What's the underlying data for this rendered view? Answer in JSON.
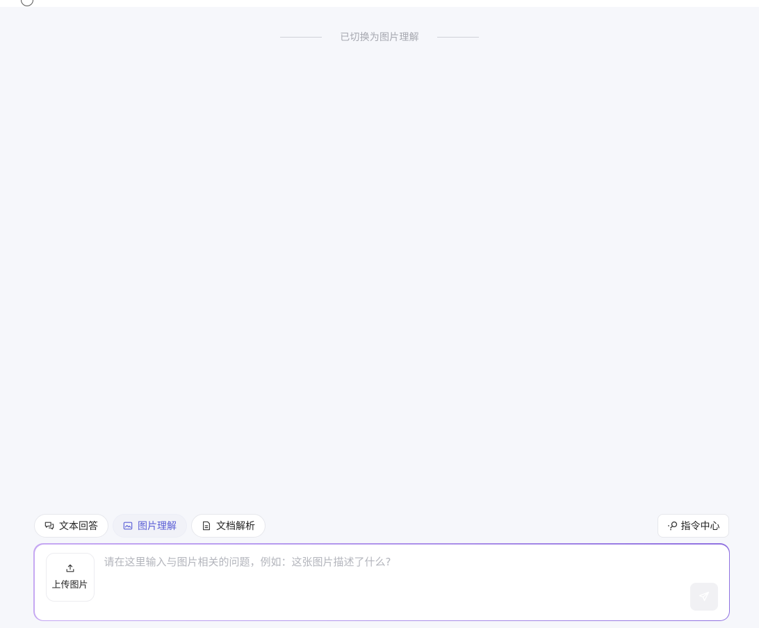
{
  "notice": {
    "text": "已切换为图片理解"
  },
  "modes": [
    {
      "label": "文本回答",
      "icon": "chat-icon",
      "active": false
    },
    {
      "label": "图片理解",
      "icon": "image-icon",
      "active": true
    },
    {
      "label": "文档解析",
      "icon": "document-icon",
      "active": false
    }
  ],
  "command_center": {
    "label": "指令中心",
    "icon": "command-icon"
  },
  "composer": {
    "upload_label": "上传图片",
    "upload_icon": "upload-icon",
    "placeholder": "请在这里输入与图片相关的问题，例如：这张图片描述了什么?",
    "value": "",
    "send_icon": "send-icon"
  },
  "colors": {
    "background": "#f6f7fb",
    "accent": "#5b5fd6",
    "input_border_gradient": [
      "#c6a8f2",
      "#8e6fe0"
    ]
  }
}
